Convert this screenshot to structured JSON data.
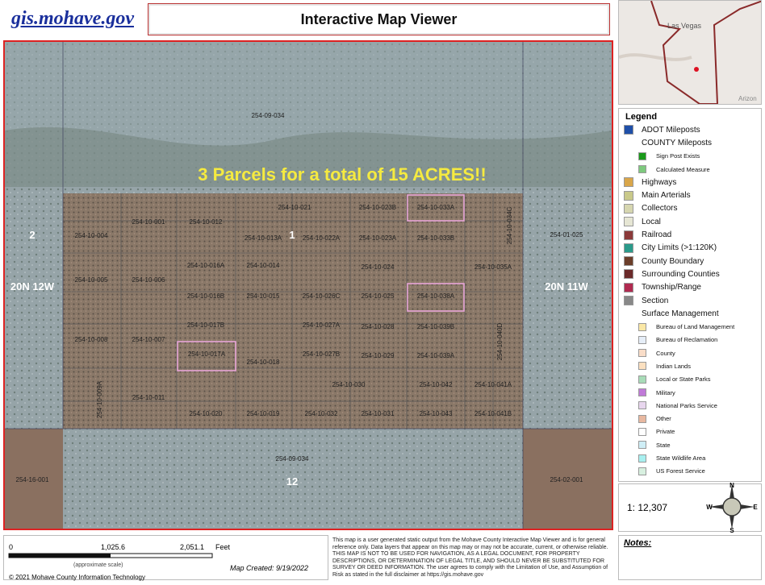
{
  "header": {
    "site_link": "gis.mohave.gov",
    "title": "Interactive Map Viewer"
  },
  "map": {
    "banner": "3 Parcels for a total of 15 ACRES!!",
    "parcels": [
      "254-09-034",
      "254-10-021",
      "254-10-023B",
      "254-10-033A",
      "254-10-001",
      "254-10-012",
      "254-10-004",
      "254-10-013A",
      "254-10-022A",
      "254-10-023A",
      "254-10-033B",
      "254-10-034C",
      "254-01-025",
      "254-10-016A",
      "254-10-014",
      "254-10-024",
      "254-10-035A",
      "254-10-005",
      "254-10-006",
      "254-10-016B",
      "254-10-015",
      "254-10-026C",
      "254-10-025",
      "254-10-038A",
      "254-10-017B",
      "254-10-027A",
      "254-10-028",
      "254-10-039B",
      "254-10-008",
      "254-10-007",
      "254-10-017A",
      "254-10-018",
      "254-10-027B",
      "254-10-029",
      "254-10-039A",
      "254-10-040D",
      "254-10-009A",
      "254-10-030",
      "254-10-042",
      "254-10-041A",
      "254-10-011",
      "254-10-020",
      "254-10-019",
      "254-10-032",
      "254-10-031",
      "254-10-043",
      "254-10-041B",
      "254-09-034",
      "254-16-001",
      "254-02-001"
    ],
    "sections": [
      "2",
      "1",
      "12"
    ],
    "townships": [
      "20N 12W",
      "20N 11W"
    ]
  },
  "inset": {
    "city": "Las Vegas",
    "state_label": "Arizon"
  },
  "legend": {
    "title": "Legend",
    "items": [
      {
        "label": "ADOT Mileposts",
        "color": "#1f4fa8"
      },
      {
        "label": "COUNTY Mileposts"
      },
      {
        "label": "Sign Post Exists",
        "color": "#1a9a1a"
      },
      {
        "label": "Calculated Measure",
        "color": "#7ec97e"
      },
      {
        "label": "Highways",
        "color": "#d9a64a"
      },
      {
        "label": "Main Arterials",
        "color": "#c9c98a"
      },
      {
        "label": "Collectors",
        "color": "#d6d6b0"
      },
      {
        "label": "Local",
        "color": "#e6e6d4"
      },
      {
        "label": "Railroad",
        "color": "#8b3a3a"
      },
      {
        "label": "City Limits (>1:120K)",
        "color": "#2a9a8a"
      },
      {
        "label": "County Boundary",
        "color": "#6b3e2a"
      },
      {
        "label": "Surrounding Counties",
        "color": "#6b2a2a"
      },
      {
        "label": "Township/Range",
        "color": "#b02a50"
      },
      {
        "label": "Section",
        "color": "#888888"
      },
      {
        "label": "Surface Management"
      },
      {
        "label": "Bureau of Land Management",
        "color": "#fbe8a6"
      },
      {
        "label": "Bureau of Reclamation",
        "color": "#e6eef8"
      },
      {
        "label": "County",
        "color": "#f9ddc8"
      },
      {
        "label": "Indian Lands",
        "color": "#fbe0c0"
      },
      {
        "label": "Local or State Parks",
        "color": "#a8dcb8"
      },
      {
        "label": "Military",
        "color": "#c07ad8"
      },
      {
        "label": "National Parks Service",
        "color": "#e8d6ee"
      },
      {
        "label": "Other",
        "color": "#e8b8a0"
      },
      {
        "label": "Private",
        "color": "#ffffff"
      },
      {
        "label": "State",
        "color": "#cfeef6"
      },
      {
        "label": "State Wildlife Area",
        "color": "#a8f0f0"
      },
      {
        "label": "US Forest Service",
        "color": "#d8f0e0"
      }
    ]
  },
  "scale": {
    "ratio": "1: 12,307",
    "compass": [
      "N",
      "E",
      "S",
      "W"
    ]
  },
  "scalebar": {
    "ticks": [
      "0",
      "1,025.6",
      "2,051.1"
    ],
    "unit": "Feet",
    "note": "(approximate scale)"
  },
  "footer": {
    "created": "Map Created: 9/19/2022",
    "copyright": "© 2021 Mohave County Information Technology",
    "disclaimer": "This map is a user generated static output from the Mohave County Interactive Map Viewer and is for general reference only. Data layers that appear on this map may or may not be accurate, current, or otherwise reliable. THIS MAP IS NOT TO BE USED FOR NAVIGATION, AS A LEGAL DOCUMENT, FOR PROPERTY DESCRIPTIONS, OR DETERMINATION OF LEGAL TITLE, AND SHOULD NEVER BE SUBSTITUTED FOR SURVEY OR DEED INFORMATION. The user agrees to comply with the Limitation of Use, and Assumption of Risk as stated in the full disclaimer at https://gis.mohave.gov",
    "notes_label": "Notes:"
  }
}
